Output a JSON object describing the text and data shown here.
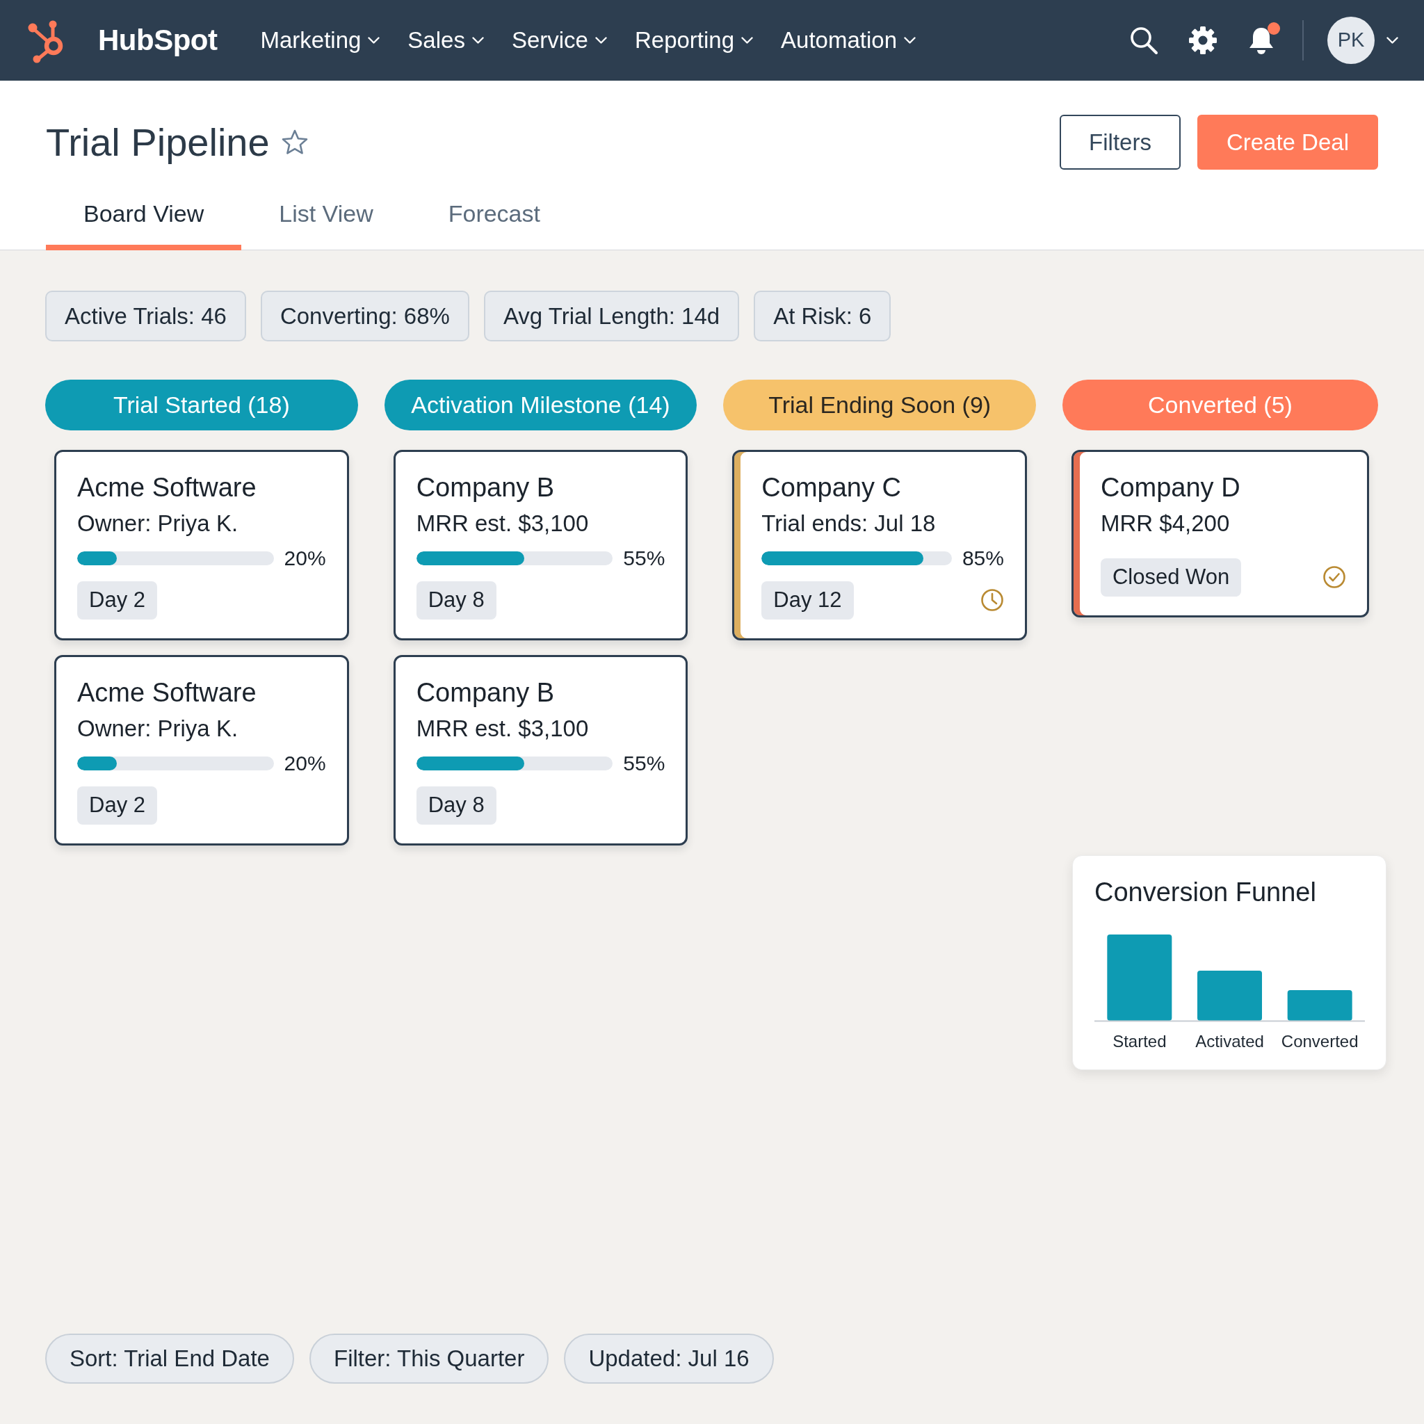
{
  "navbar": {
    "brand": "HubSpot",
    "menu": [
      {
        "label": "Marketing"
      },
      {
        "label": "Sales"
      },
      {
        "label": "Service"
      },
      {
        "label": "Reporting"
      },
      {
        "label": "Automation"
      }
    ],
    "notifications_unread": true,
    "avatar": "PK"
  },
  "header": {
    "title": "Trial Pipeline",
    "starred": false,
    "buttons": [
      {
        "label": "Filters",
        "kind": "outline"
      },
      {
        "label": "Create Deal",
        "kind": "primary"
      }
    ]
  },
  "tabs": [
    {
      "label": "Board View",
      "selected": true
    },
    {
      "label": "List View",
      "selected": false
    },
    {
      "label": "Forecast",
      "selected": false
    }
  ],
  "stats": [
    "Active Trials: 46",
    "Converting: 68%",
    "Avg Trial Length: 14d",
    "At Risk: 6"
  ],
  "columns": [
    {
      "title": "Trial Started (18)",
      "color": "#0e9bb3",
      "cards": [
        {
          "kind": "progress",
          "name": "Acme Software",
          "detail": "Owner: Priya K.",
          "level": 0.2,
          "percent": "20%",
          "tag": "Day 2"
        },
        {
          "kind": "progress",
          "name": "Acme Software",
          "detail": "Owner: Priya K.",
          "level": 0.2,
          "percent": "20%",
          "tag": "Day 2"
        }
      ]
    },
    {
      "title": "Activation Milestone (14)",
      "color": "#0e9bb3",
      "cards": [
        {
          "kind": "progress",
          "name": "Company B",
          "detail": "MRR est. $3,100",
          "level": 0.55,
          "percent": "55%",
          "tag": "Day 8"
        },
        {
          "kind": "progress",
          "name": "Company B",
          "detail": "MRR est. $3,100",
          "level": 0.55,
          "percent": "55%",
          "tag": "Day 8"
        }
      ]
    },
    {
      "title": "Trial Ending Soon (9)",
      "color": "#f6c26b",
      "cards": [
        {
          "kind": "ending",
          "name": "Company C",
          "detail": "Trial ends: Jul 18",
          "level": 0.85,
          "percent": "85%",
          "tag": "Day 12"
        }
      ]
    },
    {
      "title": "Converted (5)",
      "color": "#ff7a59",
      "cards": [
        {
          "kind": "won",
          "name": "Company D",
          "detail": "MRR $4,200",
          "tag": "Closed Won"
        }
      ]
    }
  ],
  "funnel": {
    "title": "Conversion Funnel",
    "categories": [
      "Started",
      "Activated",
      "Converted"
    ]
  },
  "footer_chips": [
    "Sort: Trial End Date",
    "Filter: This Quarter",
    "Updated: Jul 16"
  ]
}
